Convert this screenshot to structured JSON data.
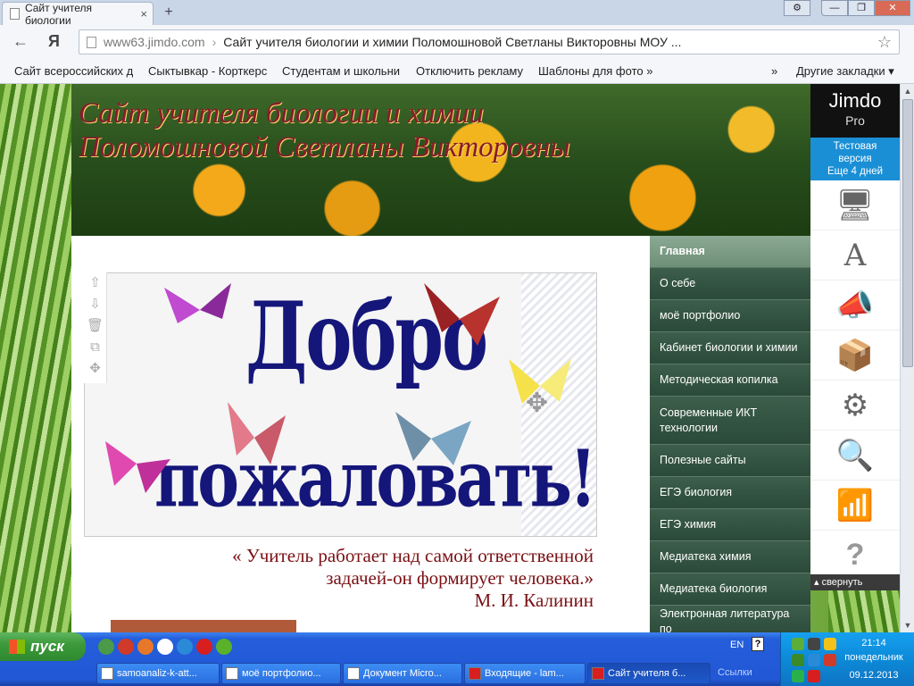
{
  "browser": {
    "tab_title": "Сайт учителя биологии",
    "tab_close": "×",
    "new_tab": "+",
    "window_buttons": [
      "⚙",
      "—",
      "❐",
      "✕"
    ],
    "nav_back": "←",
    "nav_yandex": "Я",
    "url_domain": "www63.jimdo.com",
    "url_sep": "›",
    "page_title": "Сайт учителя биологии и химии Поломошновой Светланы Викторовны МОУ ...",
    "star": "☆",
    "bookmarks": [
      "Сайт всероссийских д",
      "Сыктывкар - Корткерс",
      "Студентам и школьни",
      "Отключить рекламу",
      "Шаблоны для фото »"
    ],
    "bookmarks_more": "»",
    "other_bookmarks": "Другие закладки ▾"
  },
  "site": {
    "title": "Сайт учителя биологии и химии\nПоломошновой Светланы Викторовны",
    "welcome_line1": "Добро",
    "welcome_line2": "пожаловать!",
    "quote": "« Учитель  работает над самой ответственной задачей-он формирует человека.»",
    "quote_author": "М. И. Калинин",
    "tool_icons": [
      "⇧",
      "⇩",
      "🗑",
      "⧉",
      "✥"
    ]
  },
  "nav": {
    "items": [
      "Главная",
      "О себе",
      "моё портфолио",
      "Кабинет биологии и химии",
      "Методическая копилка",
      "Современные ИКТ технологии",
      "Полезные сайты",
      "ЕГЭ биология",
      "ЕГЭ химия",
      "Медиатека химия",
      "Медиатека биология",
      "Электронная литература по"
    ]
  },
  "jimdo": {
    "logo": "Jimdo",
    "plan": "Pro",
    "trial_line1": "Тестовая",
    "trial_line2": "версия",
    "trial_line3": "Еще 4 дней",
    "collapse": "свернуть",
    "tool_icons": [
      "🖥",
      "A",
      "📣",
      "📦",
      "⚙",
      "🔍",
      "📶",
      "?"
    ]
  },
  "taskbar": {
    "start": "пуск",
    "tasks": [
      "samoanaliz-k-att...",
      "моё портфолио...",
      "Документ Micro...",
      "Входящие - lam...",
      "Сайт учителя б..."
    ],
    "links": "Ссылки",
    "lang": "EN",
    "help": "?",
    "time": "21:14",
    "day": "понедельник",
    "date": "09.12.2013"
  }
}
